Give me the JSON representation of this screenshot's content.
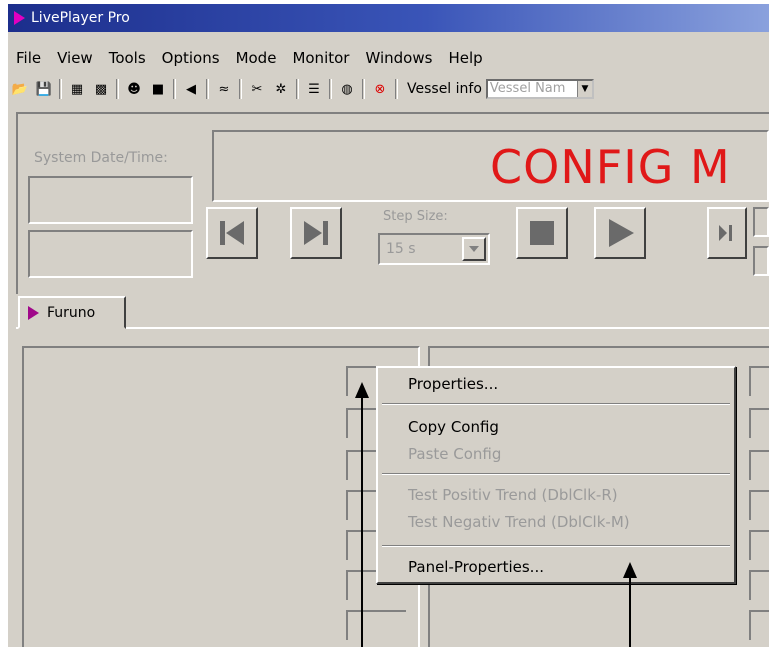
{
  "window": {
    "title": "LivePlayer Pro"
  },
  "menubar": [
    "File",
    "View",
    "Tools",
    "Options",
    "Mode",
    "Monitor",
    "Windows",
    "Help"
  ],
  "toolbar": {
    "vessel_label": "Vessel info",
    "vessel_placeholder": "Vessel Nam",
    "icons": [
      "open-folder-icon",
      "save-icon",
      "config-icon",
      "config2-icon",
      "user-icon",
      "screen-icon",
      "speaker-icon",
      "chart-icon",
      "tools-icon",
      "settings-icon",
      "list-icon",
      "globe-icon",
      "stop-icon"
    ]
  },
  "controls": {
    "sysdate_label": "System Date/Time:",
    "config_text": "CONFIG M",
    "stepsize_label": "Step Size:",
    "stepsize_value": "15 s"
  },
  "tabs": [
    "Furuno"
  ],
  "context_menu": {
    "items": [
      {
        "label": "Properties...",
        "enabled": true
      },
      {
        "label": "Copy Config",
        "enabled": true
      },
      {
        "label": "Paste Config",
        "enabled": false
      },
      {
        "label": "Test Positiv Trend (DblClk-R)",
        "enabled": false
      },
      {
        "label": "Test Negativ Trend (DblClk-M)",
        "enabled": false
      },
      {
        "label": "Panel-Properties...",
        "enabled": true
      }
    ]
  },
  "colors": {
    "title_bar": "#1c2e8c",
    "config_text": "#e01818",
    "face": "#d4d0c8"
  }
}
